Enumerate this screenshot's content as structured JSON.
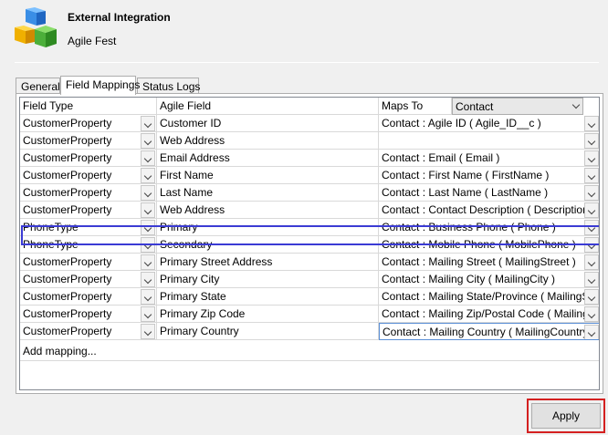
{
  "app": {
    "title": "External Integration",
    "subtitle": "Agile Fest",
    "icon": "cubes-icon"
  },
  "tabs": [
    {
      "label": "General",
      "active": false
    },
    {
      "label": "Field Mappings",
      "active": true
    },
    {
      "label": "Status Logs",
      "active": false
    }
  ],
  "grid": {
    "headers": {
      "field_type": "Field Type",
      "agile_field": "Agile Field",
      "maps_to": "Maps To",
      "maps_to_entity": "Contact"
    },
    "rows": [
      {
        "field_type": "CustomerProperty",
        "agile_field": "Customer ID",
        "maps_to": "Contact : Agile ID ( Agile_ID__c )"
      },
      {
        "field_type": "CustomerProperty",
        "agile_field": "Web Address",
        "maps_to": ""
      },
      {
        "field_type": "CustomerProperty",
        "agile_field": "Email Address",
        "maps_to": "Contact : Email ( Email )"
      },
      {
        "field_type": "CustomerProperty",
        "agile_field": "First Name",
        "maps_to": "Contact : First Name ( FirstName )"
      },
      {
        "field_type": "CustomerProperty",
        "agile_field": "Last Name",
        "maps_to": "Contact : Last Name ( LastName )"
      },
      {
        "field_type": "CustomerProperty",
        "agile_field": "Web Address",
        "maps_to": "Contact : Contact Description ( Description )"
      },
      {
        "field_type": "PhoneType",
        "agile_field": "Primary",
        "maps_to": "Contact : Business Phone ( Phone )"
      },
      {
        "field_type": "PhoneType",
        "agile_field": "Secondary",
        "maps_to": "Contact : Mobile Phone ( MobilePhone )"
      },
      {
        "field_type": "CustomerProperty",
        "agile_field": "Primary Street Address",
        "maps_to": "Contact : Mailing Street ( MailingStreet )"
      },
      {
        "field_type": "CustomerProperty",
        "agile_field": "Primary City",
        "maps_to": "Contact : Mailing City ( MailingCity )"
      },
      {
        "field_type": "CustomerProperty",
        "agile_field": "Primary State",
        "maps_to": "Contact : Mailing State/Province ( MailingSta"
      },
      {
        "field_type": "CustomerProperty",
        "agile_field": "Primary Zip Code",
        "maps_to": "Contact : Mailing Zip/Postal Code ( MailingPo"
      },
      {
        "field_type": "CustomerProperty",
        "agile_field": "Primary Country",
        "maps_to": "Contact : Mailing Country ( MailingCountry )"
      }
    ],
    "add_mapping_label": "Add mapping..."
  },
  "footer": {
    "apply_label": "Apply"
  },
  "colors": {
    "highlight_row_border": "#3b3bd4",
    "apply_highlight_border": "#d42020"
  }
}
